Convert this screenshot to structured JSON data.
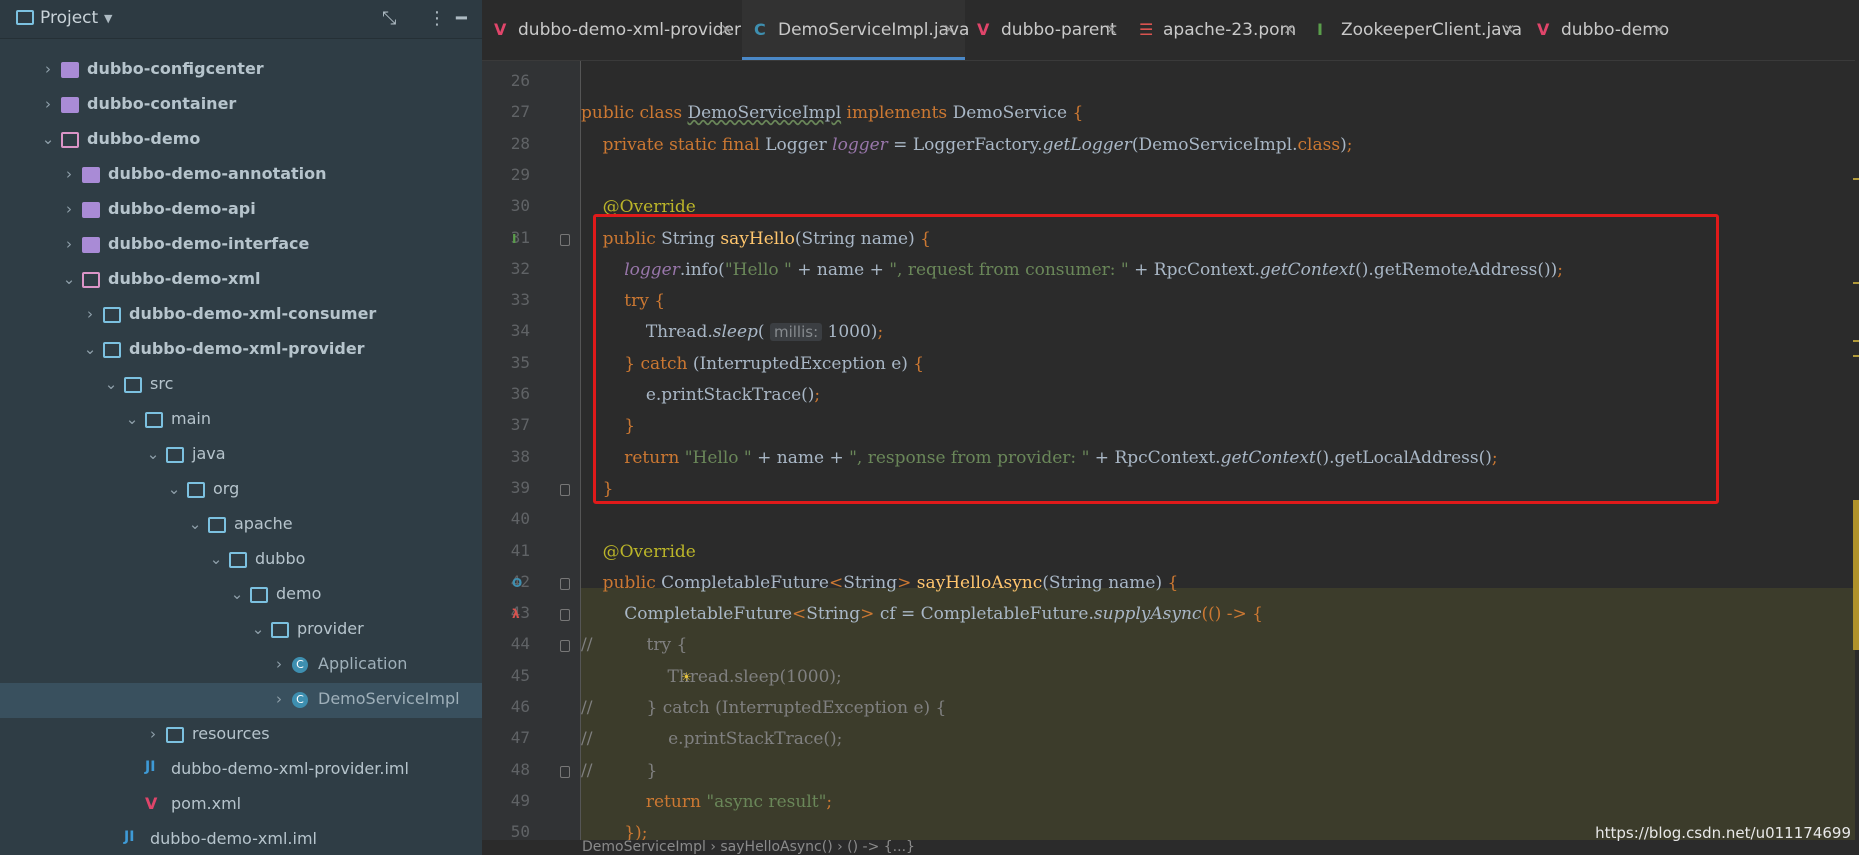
{
  "project_panel": {
    "title": "Project",
    "tree": [
      {
        "label": "dubbo-configcenter",
        "level": 1,
        "expanded": false,
        "type": "module",
        "bold": true
      },
      {
        "label": "dubbo-container",
        "level": 1,
        "expanded": false,
        "type": "module",
        "bold": true
      },
      {
        "label": "dubbo-demo",
        "level": 1,
        "expanded": true,
        "type": "folder-pink",
        "bold": true
      },
      {
        "label": "dubbo-demo-annotation",
        "level": 2,
        "expanded": false,
        "type": "module",
        "bold": true
      },
      {
        "label": "dubbo-demo-api",
        "level": 2,
        "expanded": false,
        "type": "module",
        "bold": true
      },
      {
        "label": "dubbo-demo-interface",
        "level": 2,
        "expanded": false,
        "type": "module",
        "bold": true
      },
      {
        "label": "dubbo-demo-xml",
        "level": 2,
        "expanded": true,
        "type": "folder-pink",
        "bold": true
      },
      {
        "label": "dubbo-demo-xml-consumer",
        "level": 3,
        "expanded": false,
        "type": "folder",
        "bold": true
      },
      {
        "label": "dubbo-demo-xml-provider",
        "level": 3,
        "expanded": true,
        "type": "folder",
        "bold": true
      },
      {
        "label": "src",
        "level": 4,
        "expanded": true,
        "type": "folder",
        "bold": false
      },
      {
        "label": "main",
        "level": 5,
        "expanded": true,
        "type": "folder",
        "bold": false
      },
      {
        "label": "java",
        "level": 6,
        "expanded": true,
        "type": "folder",
        "bold": false
      },
      {
        "label": "org",
        "level": 7,
        "expanded": true,
        "type": "folder",
        "bold": false
      },
      {
        "label": "apache",
        "level": 8,
        "expanded": true,
        "type": "folder",
        "bold": false
      },
      {
        "label": "dubbo",
        "level": 9,
        "expanded": true,
        "type": "folder",
        "bold": false
      },
      {
        "label": "demo",
        "level": 10,
        "expanded": true,
        "type": "folder",
        "bold": false
      },
      {
        "label": "provider",
        "level": 11,
        "expanded": true,
        "type": "folder",
        "bold": false
      },
      {
        "label": "Application",
        "level": 12,
        "expanded": false,
        "type": "class",
        "bold": false
      },
      {
        "label": "DemoServiceImpl",
        "level": 12,
        "expanded": false,
        "type": "class",
        "bold": false,
        "selected": true
      },
      {
        "label": "resources",
        "level": 6,
        "expanded": false,
        "type": "folder",
        "bold": false
      },
      {
        "label": "dubbo-demo-xml-provider.iml",
        "level": 5,
        "expanded": null,
        "type": "iml",
        "bold": false
      },
      {
        "label": "pom.xml",
        "level": 5,
        "expanded": null,
        "type": "maven",
        "bold": false
      },
      {
        "label": "dubbo-demo-xml.iml",
        "level": 4,
        "expanded": null,
        "type": "iml",
        "bold": false
      }
    ]
  },
  "tabs": [
    {
      "label": "dubbo-demo-xml-provider",
      "icon": "maven-icon",
      "active": false
    },
    {
      "label": "DemoServiceImpl.java",
      "icon": "class-icon",
      "active": true
    },
    {
      "label": "dubbo-parent",
      "icon": "maven-icon",
      "active": false
    },
    {
      "label": "apache-23.pom",
      "icon": "pom-icon",
      "active": false
    },
    {
      "label": "ZookeeperClient.java",
      "icon": "interface-icon",
      "active": false
    },
    {
      "label": "dubbo-demo",
      "icon": "maven-icon",
      "active": false
    }
  ],
  "editor": {
    "lines": [
      {
        "n": "26",
        "segs": []
      },
      {
        "n": "27",
        "segs": [
          [
            "kw",
            "public class "
          ],
          [
            "u",
            "DemoServiceImpl"
          ],
          [
            "kw",
            " implements "
          ],
          [
            "p",
            "DemoService "
          ],
          [
            "kw",
            "{"
          ]
        ]
      },
      {
        "n": "28",
        "segs": [
          [
            "p",
            "    "
          ],
          [
            "kw",
            "private static final "
          ],
          [
            "p",
            "Logger "
          ],
          [
            "fld",
            "logger"
          ],
          [
            "p",
            " = LoggerFactory."
          ],
          [
            "ital",
            "getLogger"
          ],
          [
            "p",
            "(DemoServiceImpl."
          ],
          [
            "kw",
            "class"
          ],
          [
            "p",
            ")"
          ],
          [
            "kw",
            ";"
          ]
        ]
      },
      {
        "n": "29",
        "segs": []
      },
      {
        "n": "30",
        "segs": [
          [
            "p",
            "    "
          ],
          [
            "ann",
            "@Override"
          ]
        ]
      },
      {
        "n": "31",
        "segs": [
          [
            "p",
            "    "
          ],
          [
            "kw",
            "public "
          ],
          [
            "p",
            "String "
          ],
          [
            "fn",
            "sayHello"
          ],
          [
            "p",
            "(String name) "
          ],
          [
            "kw",
            "{"
          ]
        ]
      },
      {
        "n": "32",
        "segs": [
          [
            "p",
            "        "
          ],
          [
            "fld",
            "logger"
          ],
          [
            "p",
            ".info("
          ],
          [
            "str",
            "\"Hello \""
          ],
          [
            "p",
            " + name + "
          ],
          [
            "str",
            "\", request from consumer: \""
          ],
          [
            "p",
            " + RpcContext."
          ],
          [
            "ital",
            "getContext"
          ],
          [
            "p",
            "().getRemoteAddress())"
          ],
          [
            "kw",
            ";"
          ]
        ]
      },
      {
        "n": "33",
        "segs": [
          [
            "p",
            "        "
          ],
          [
            "kw",
            "try {"
          ]
        ]
      },
      {
        "n": "34",
        "segs": [
          [
            "p",
            "            Thread."
          ],
          [
            "ital",
            "sleep"
          ],
          [
            "p",
            "( "
          ],
          [
            "hint",
            "millis:"
          ],
          [
            "p",
            " 1000)"
          ],
          [
            "kw",
            ";"
          ]
        ]
      },
      {
        "n": "35",
        "segs": [
          [
            "p",
            "        "
          ],
          [
            "kw",
            "} catch "
          ],
          [
            "p",
            "(InterruptedException e) "
          ],
          [
            "kw",
            "{"
          ]
        ]
      },
      {
        "n": "36",
        "segs": [
          [
            "p",
            "            e.printStackTrace()"
          ],
          [
            "kw",
            ";"
          ]
        ]
      },
      {
        "n": "37",
        "segs": [
          [
            "p",
            "        "
          ],
          [
            "kw",
            "}"
          ]
        ]
      },
      {
        "n": "38",
        "segs": [
          [
            "p",
            "        "
          ],
          [
            "kw",
            "return "
          ],
          [
            "str",
            "\"Hello \""
          ],
          [
            "p",
            " + name + "
          ],
          [
            "str",
            "\", response from provider: \""
          ],
          [
            "p",
            " + RpcContext."
          ],
          [
            "ital",
            "getContext"
          ],
          [
            "p",
            "().getLocalAddress()"
          ],
          [
            "kw",
            ";"
          ]
        ]
      },
      {
        "n": "39",
        "segs": [
          [
            "p",
            "    "
          ],
          [
            "kw",
            "}"
          ]
        ]
      },
      {
        "n": "40",
        "segs": []
      },
      {
        "n": "41",
        "segs": [
          [
            "p",
            "    "
          ],
          [
            "ann",
            "@Override"
          ]
        ]
      },
      {
        "n": "42",
        "segs": [
          [
            "p",
            "    "
          ],
          [
            "kw",
            "public "
          ],
          [
            "p",
            "CompletableFuture"
          ],
          [
            "kw",
            "<"
          ],
          [
            "p",
            "String"
          ],
          [
            "kw",
            "> "
          ],
          [
            "fn",
            "sayHelloAsync"
          ],
          [
            "p",
            "(String name) "
          ],
          [
            "kw",
            "{"
          ]
        ]
      },
      {
        "n": "43",
        "segs": [
          [
            "p",
            "        CompletableFuture"
          ],
          [
            "kw",
            "<"
          ],
          [
            "p",
            "String"
          ],
          [
            "kw",
            "> "
          ],
          [
            "p",
            "cf = CompletableFuture."
          ],
          [
            "ital",
            "supplyAsync"
          ],
          [
            "kw",
            "(() -> {"
          ]
        ]
      },
      {
        "n": "44",
        "segs": [
          [
            "cmt",
            "//          try {"
          ]
        ]
      },
      {
        "n": "45",
        "segs": [
          [
            "cmt",
            "                Thread.sleep(1000);"
          ]
        ]
      },
      {
        "n": "46",
        "segs": [
          [
            "cmt",
            "//          } catch (InterruptedException e) {"
          ]
        ]
      },
      {
        "n": "47",
        "segs": [
          [
            "cmt",
            "//              e.printStackTrace();"
          ]
        ]
      },
      {
        "n": "48",
        "segs": [
          [
            "cmt",
            "//          }"
          ]
        ]
      },
      {
        "n": "49",
        "segs": [
          [
            "p",
            "            "
          ],
          [
            "kw",
            "return "
          ],
          [
            "str",
            "\"async result\""
          ],
          [
            "kw",
            ";"
          ]
        ]
      },
      {
        "n": "50",
        "segs": [
          [
            "p",
            "        "
          ],
          [
            "kw",
            "})"
          ],
          [
            "kw",
            ";"
          ]
        ]
      }
    ]
  },
  "breadcrumb": "DemoServiceImpl  ›  sayHelloAsync()  ›  () -> {...}",
  "watermark": "https://blog.csdn.net/u011174699"
}
